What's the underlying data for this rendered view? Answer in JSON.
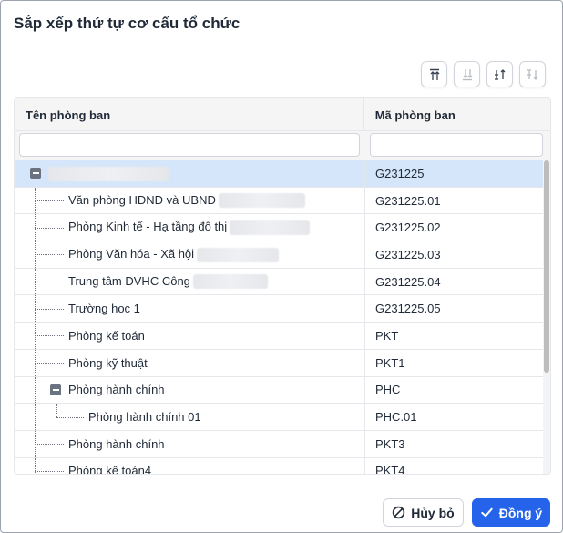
{
  "dialog": {
    "title": "Sắp xếp thứ tự cơ cấu tổ chức"
  },
  "toolbar": {
    "buttons": [
      {
        "icon": "move-to-top-icon",
        "enabled": true
      },
      {
        "icon": "move-to-bottom-icon",
        "enabled": false
      },
      {
        "icon": "move-up-icon",
        "enabled": true
      },
      {
        "icon": "move-down-icon",
        "enabled": false
      }
    ]
  },
  "grid": {
    "columns": {
      "name": "Tên phòng ban",
      "code": "Mã phòng ban"
    },
    "filters": {
      "name_value": "",
      "code_value": ""
    },
    "rows": [
      {
        "name": "",
        "code": "G231225",
        "level": 0,
        "expanded": true,
        "selected": true,
        "redacted": true
      },
      {
        "name": "Văn phòng HĐND và UBND",
        "code": "G231225.01",
        "level": 1,
        "redacted": true
      },
      {
        "name": "Phòng Kinh tế - Hạ tầng đô thị",
        "code": "G231225.02",
        "level": 1,
        "redacted": true
      },
      {
        "name": "Phòng Văn hóa - Xã hội",
        "code": "G231225.03",
        "level": 1,
        "redacted": true
      },
      {
        "name": "Trung tâm DVHC Công",
        "code": "G231225.04",
        "level": 1,
        "redacted": true
      },
      {
        "name": "Trường hoc 1",
        "code": "G231225.05",
        "level": 1
      },
      {
        "name": "Phòng kế toán",
        "code": "PKT",
        "level": 1
      },
      {
        "name": "Phòng kỹ thuật",
        "code": "PKT1",
        "level": 1
      },
      {
        "name": "Phòng hành chính",
        "code": "PHC",
        "level": 1,
        "expanded": true
      },
      {
        "name": "Phòng hành chính 01",
        "code": "PHC.01",
        "level": 2
      },
      {
        "name": "Phòng hành chính",
        "code": "PKT3",
        "level": 1
      },
      {
        "name": "Phòng kế toán4",
        "code": "PKT4",
        "level": 1
      }
    ]
  },
  "footer": {
    "cancel_label": "Hủy bỏ",
    "ok_label": "Đồng ý"
  },
  "colors": {
    "primary": "#2563eb",
    "selected_row": "#d6e6fa",
    "header_bg": "#f5f5f5"
  }
}
